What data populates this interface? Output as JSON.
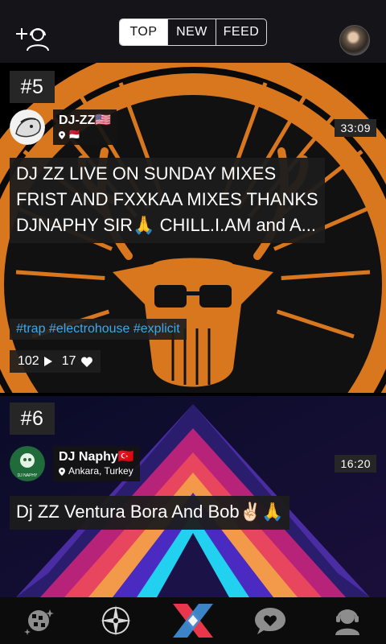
{
  "header": {
    "tabs": [
      {
        "label": "TOP",
        "active": true
      },
      {
        "label": "NEW",
        "active": false
      },
      {
        "label": "FEED",
        "active": false
      }
    ],
    "add_friend_icon": "add-user-icon",
    "profile_icon": "profile-avatar"
  },
  "cards": [
    {
      "rank": "#5",
      "user_name": "DJ-ZZ",
      "user_name_suffix": "🇺🇸",
      "location": "🇲🇨",
      "duration": "33:09",
      "title_lines": [
        "DJ ZZ LIVE ON SUNDAY MIXES",
        "FRIST AND FXXKAA MIXES THANKS",
        "DJNAPHY SIR🙏 CHILL.I.AM and A..."
      ],
      "tags": "#trap #electrohouse #explicit",
      "plays": "102",
      "likes": "17"
    },
    {
      "rank": "#6",
      "user_name": "DJ Naphy",
      "user_name_suffix": "🇹🇷",
      "location": "Ankara, Turkey",
      "duration": "16:20",
      "title_lines": [
        "Dj ZZ Ventura Bora And Bob✌🏻🙏"
      ],
      "avatar_text": "DJ NAPHY"
    }
  ],
  "bottom_nav": [
    {
      "name": "discover-icon"
    },
    {
      "name": "compass-icon"
    },
    {
      "name": "app-logo-icon"
    },
    {
      "name": "messages-icon"
    },
    {
      "name": "profile-icon"
    }
  ],
  "colors": {
    "header_bg": "#141419",
    "accent_orange": "#d9771e",
    "tag_blue": "#3fa8e8",
    "logo_red": "#e8364a",
    "logo_blue": "#3f8fd8"
  }
}
